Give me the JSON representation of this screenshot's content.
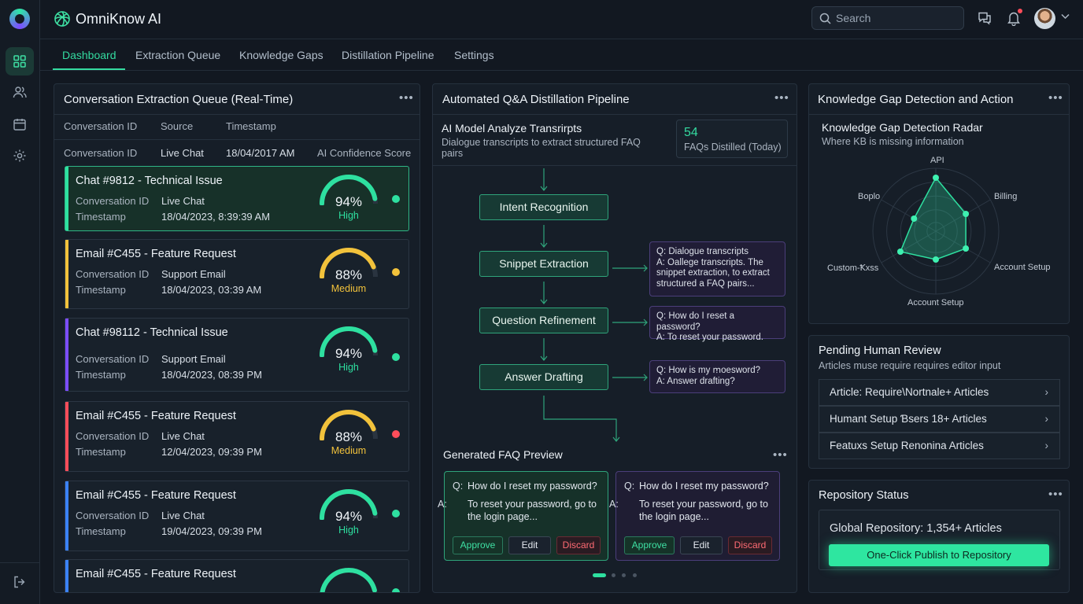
{
  "app": {
    "name": "OmniKnow AI"
  },
  "header": {
    "search_placeholder": "Search"
  },
  "tabs": [
    {
      "label": "Dashboard"
    },
    {
      "label": "Extraction Queue"
    },
    {
      "label": "Knowledge Gaps"
    },
    {
      "label": "Distillation Pipeline"
    },
    {
      "label": "Settings"
    }
  ],
  "queue": {
    "title": "Conversation Extraction Queue (Real-Time)",
    "header_cols": [
      "Conversation ID",
      "Source",
      "Timestamp"
    ],
    "header_row": [
      "Conversation ID",
      "Live Chat",
      "18/04/2017 AM",
      "AI Confidence Score"
    ],
    "items": [
      {
        "title": "Chat #9812 - Technical Issue",
        "k1": "Conversation ID",
        "v1": "Live Chat",
        "k2": "Timestamp",
        "v2": "18/04/2023, 8:39:39 AM",
        "pct": "94%",
        "level": "High",
        "confidence": 0.94,
        "color": "#2ee0a0",
        "dot": "#2ee0a0",
        "selected": true
      },
      {
        "title": "Email #C455 - Feature Request",
        "k1": "Conversation ID",
        "v1": "Support Email",
        "k2": "Timestamp",
        "v2": "18/04/2023, 03:39 AM",
        "pct": "88%",
        "level": "Medium",
        "confidence": 0.88,
        "color": "#f2c23b",
        "dot": "#f2c23b",
        "selected": false
      },
      {
        "title": "Chat #98112 - Technical Issue",
        "k1": "Conversation ID",
        "v1": "Support Email",
        "k2": "Timestamp",
        "v2": "18/04/2023, 08:39 PM",
        "pct": "94%",
        "level": "High",
        "confidence": 0.94,
        "color": "#2ee0a0",
        "dot": "#2ee0a0",
        "selected": false
      },
      {
        "title": "Email #C455 - Feature Request",
        "k1": "Conversation ID",
        "v1": "Live Chat",
        "k2": "Timestamp",
        "v2": "12/04/2023, 09:39 PM",
        "pct": "88%",
        "level": "Medium",
        "confidence": 0.88,
        "color": "#f2c23b",
        "dot": "#ff4d5a",
        "selected": false
      },
      {
        "title": "Email #C455 - Feature Request",
        "k1": "Conversation ID",
        "v1": "Live Chat",
        "k2": "Timestamp",
        "v2": "19/04/2023, 09:39 PM",
        "pct": "94%",
        "level": "High",
        "confidence": 0.94,
        "color": "#2ee0a0",
        "dot": "#2ee0a0",
        "selected": false
      },
      {
        "title": "Email #C455 - Feature Request",
        "k1": "",
        "v1": "",
        "k2": "",
        "v2": "",
        "pct": "",
        "level": "",
        "confidence": 0.92,
        "color": "#2ee0a0",
        "dot": "#2ee0a0",
        "selected": false
      }
    ],
    "bar_colors": [
      "#2ee0a0",
      "#f2c23b",
      "#7c4dff",
      "#ff4d5a",
      "#3b82f6",
      "#3b82f6"
    ]
  },
  "pipeline": {
    "title": "Automated Q&A Distillation Pipeline",
    "intro_title": "AI Model Analyze Transrirpts",
    "intro_sub": "Dialogue transcripts to extract structured FAQ pairs",
    "stat_value": "54",
    "stat_label": "FAQs Distilled (Today)",
    "stages": [
      "Intent Recognition",
      "Snippet Extraction",
      "Question Refinement",
      "Answer Drafting"
    ],
    "notes": [
      {
        "q": "Q: Dialogue transcripts",
        "a": "A: Oallege transcripts. The snippet extraction, to extract structured a FAQ pairs..."
      },
      {
        "q": "Q: How do I reset a password?",
        "a": "A: To reset your password."
      },
      {
        "q": "Q: How is my ꭑoesword?",
        "a": "A: Answer drafting?"
      }
    ],
    "faq_title": "Generated FAQ Preview",
    "faqs": [
      {
        "q_mark": "Q:",
        "q": "How do I reset my password?",
        "a_mark": "A:",
        "a": "To reset your password, go to the login page..."
      },
      {
        "q_mark": "Q:",
        "q": "How do I reset my password?",
        "a_mark": "A:",
        "a": "To reset your password, go to the login page..."
      }
    ],
    "actions": {
      "approve": "Approve",
      "edit": "Edit",
      "discard": "Discard"
    }
  },
  "gaps": {
    "title": "Knowledge Gap Detection and Action",
    "radar_title": "Knowledge Gap Detection Radar",
    "radar_sub": "Where KB is missing information",
    "labels": [
      "API",
      "Billing",
      "Account Setup",
      "Account Setup",
      "Custom-Ꝁxss",
      "Boplo"
    ],
    "values": [
      0.85,
      0.55,
      0.55,
      0.45,
      0.65,
      0.4
    ]
  },
  "review": {
    "title": "Pending Human Review",
    "subtitle": "Articles muse require requires editor input",
    "items": [
      "Article: Require\\Nortnale+ Articles",
      "Humant Setup Ɓsers 18+ Articles",
      "Featuxs Setup Renonina Articles"
    ]
  },
  "repo": {
    "title": "Repository Status",
    "status": "Global Repository: 1,354+ Articles",
    "publish_label": "One-Click Publish to Repository"
  },
  "colors": {
    "accent": "#2ee0a0",
    "warning": "#f2c23b",
    "danger": "#ff4d5a",
    "purple": "#7c4dff"
  }
}
